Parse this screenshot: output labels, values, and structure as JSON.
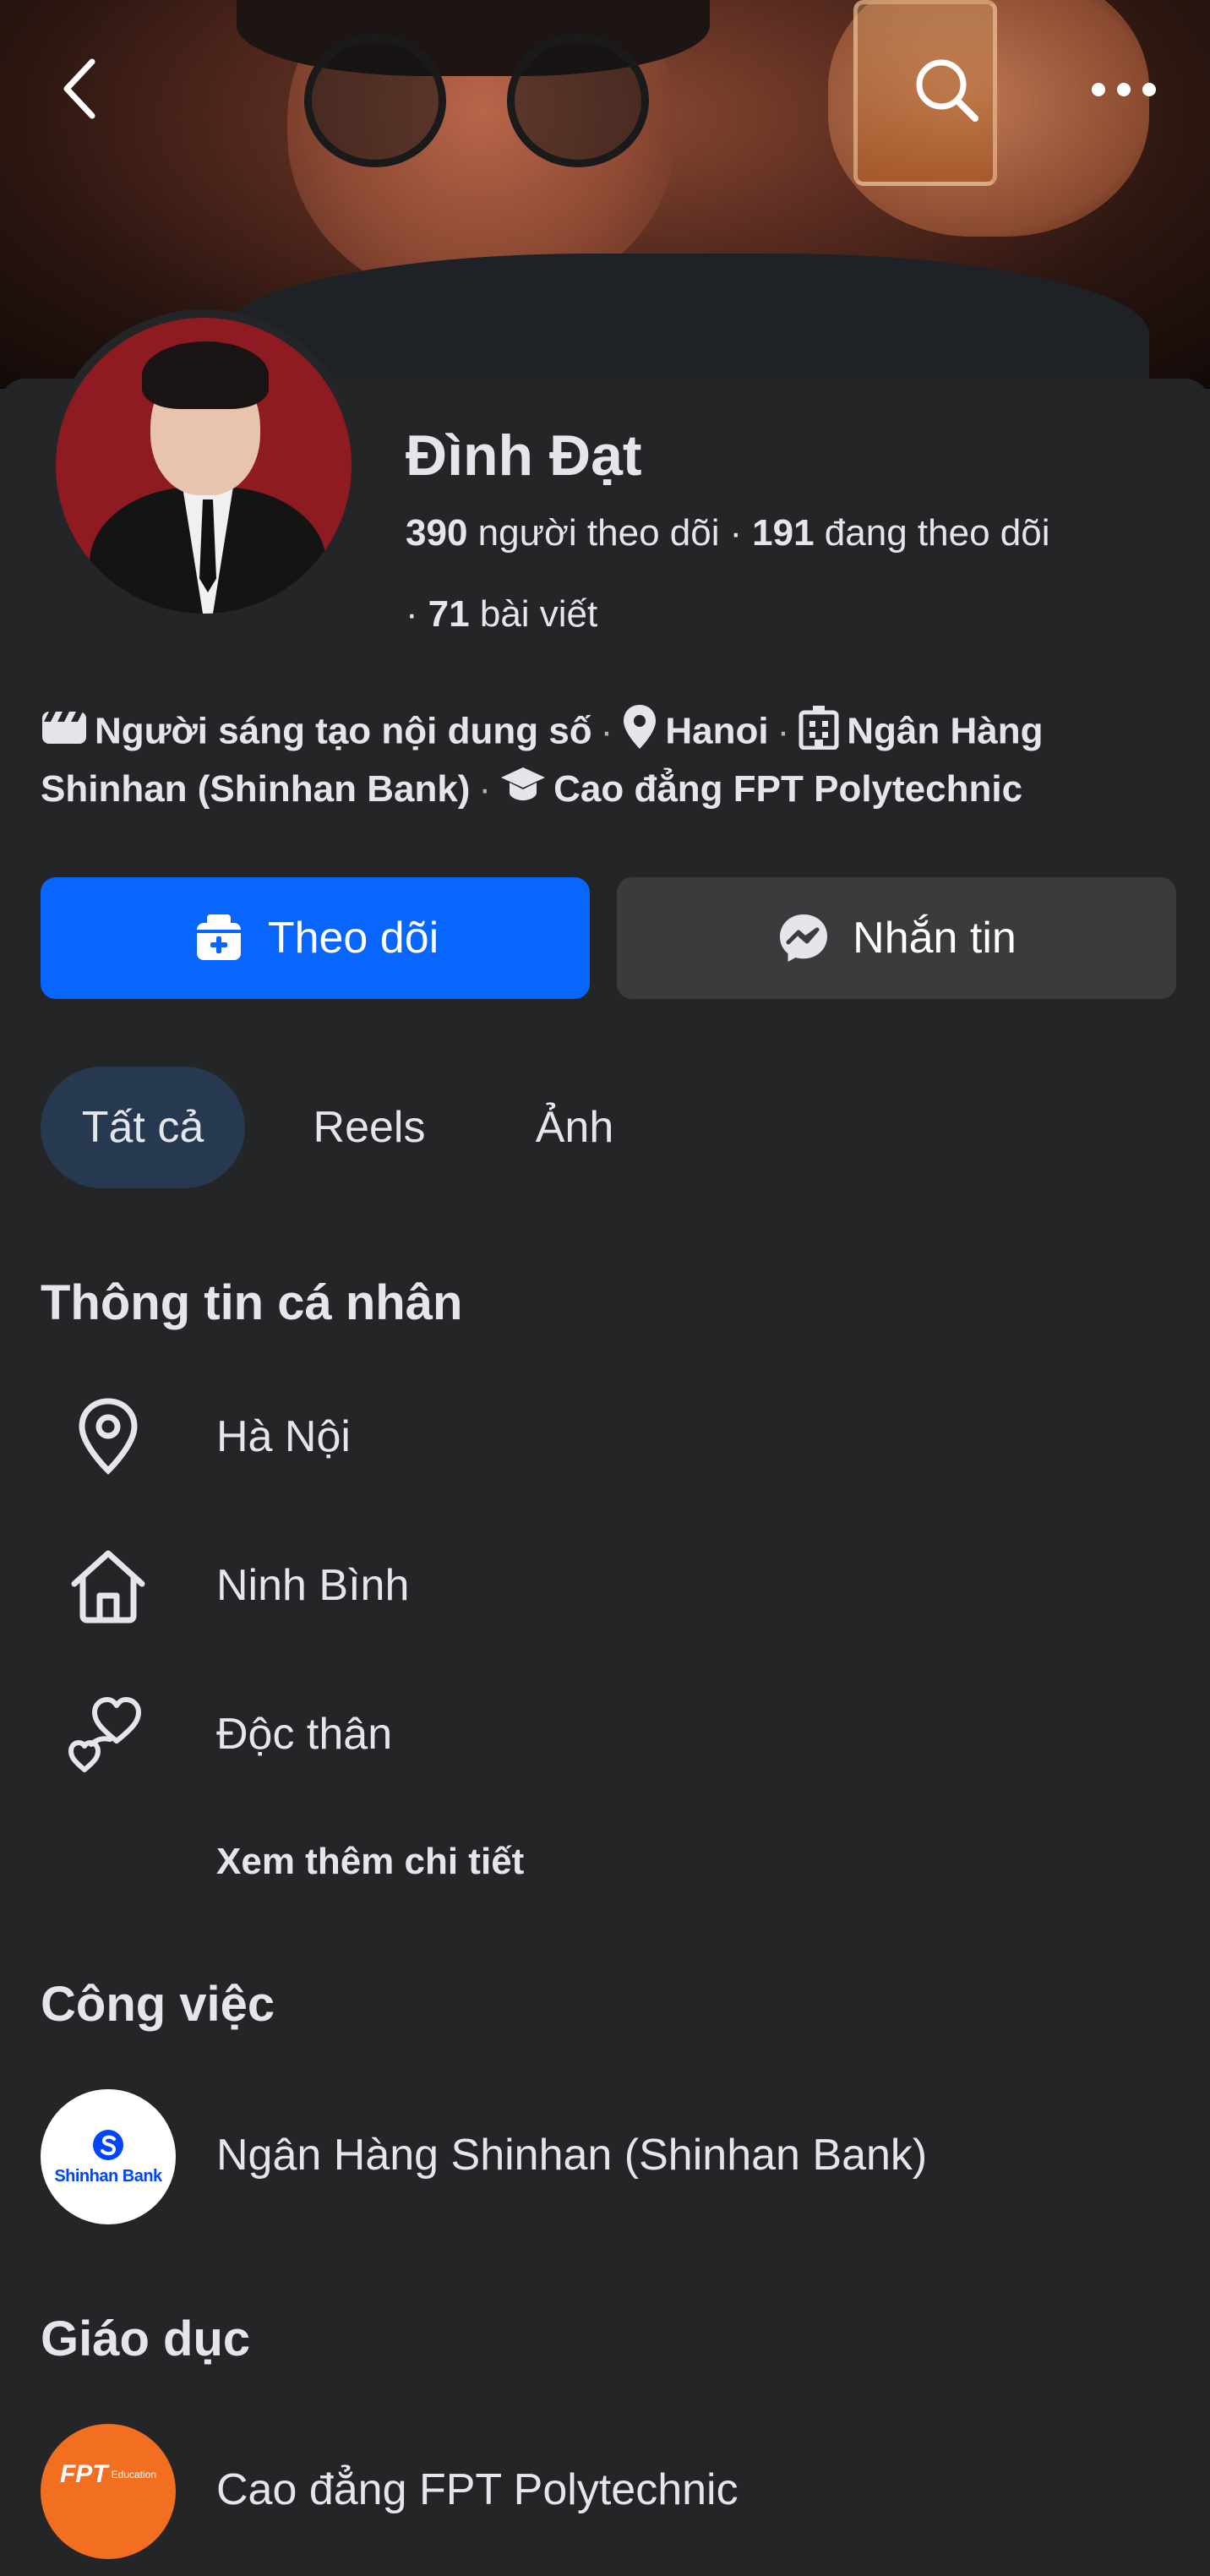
{
  "profile": {
    "name": "Đình Đạt",
    "followers_count": "390",
    "followers_label": "người theo dõi",
    "following_count": "191",
    "following_label": "đang theo dõi",
    "posts_count": "71",
    "posts_label": "bài viết"
  },
  "intro": {
    "creator": "Người sáng tạo nội dung số",
    "location": "Hanoi",
    "work": "Ngân Hàng Shinhan (Shinhan Bank)",
    "education": "Cao đẳng FPT Polytechnic"
  },
  "actions": {
    "follow_label": "Theo dõi",
    "message_label": "Nhắn tin"
  },
  "tabs": [
    {
      "label": "Tất cả",
      "active": true
    },
    {
      "label": "Reels",
      "active": false
    },
    {
      "label": "Ảnh",
      "active": false
    }
  ],
  "personal_info": {
    "title": "Thông tin cá nhân",
    "items": [
      {
        "icon": "location-pin-icon",
        "text": "Hà Nội"
      },
      {
        "icon": "home-icon",
        "text": "Ninh Bình"
      },
      {
        "icon": "hearts-icon",
        "text": "Độc thân"
      }
    ],
    "see_more": "Xem thêm chi tiết"
  },
  "work_section": {
    "title": "Công việc",
    "company": "Ngân Hàng Shinhan (Shinhan Bank)",
    "logo_text": "Shinhan Bank"
  },
  "education_section": {
    "title": "Giáo dục",
    "school": "Cao đẳng FPT Polytechnic",
    "logo_text": "FPT",
    "logo_subtext": "Education"
  },
  "colors": {
    "background": "#242526",
    "primary_button": "#0866ff",
    "secondary_button": "#3a3b3c",
    "active_tab": "#263951",
    "text": "#e4e6eb"
  }
}
